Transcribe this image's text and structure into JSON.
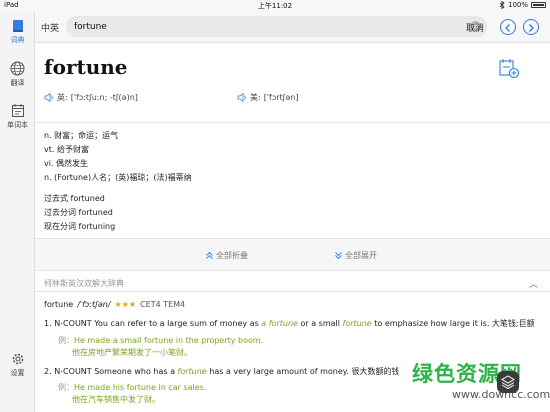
{
  "status": {
    "device": "iPad",
    "time": "上午11:02",
    "battery": "100%"
  },
  "sidebar": {
    "items": [
      {
        "label": "词典",
        "icon": "book-icon"
      },
      {
        "label": "翻译",
        "icon": "globe-icon"
      },
      {
        "label": "单词本",
        "icon": "calendar-icon"
      },
      {
        "label": "设置",
        "icon": "gear-icon"
      }
    ],
    "active_color": "#2f7fd8"
  },
  "topbar": {
    "lang": "中英",
    "query": "fortune",
    "placeholder": "",
    "cancel": "取消"
  },
  "word": {
    "headword": "fortune",
    "uk_label": "英:",
    "uk_ipa": "['fɔːtʃuːn; -tʃ(ə)n]",
    "us_label": "美:",
    "us_ipa": "['fɔrtʃən]"
  },
  "definitions": [
    "n. 财富；命运；运气",
    "vt. 给予财富",
    "vi. 偶然发生",
    "n. (Fortune)人名；(英)福琼；(法)福蒂纳"
  ],
  "forms": [
    "过去式 fortuned",
    "过去分词 fortuned",
    "现在分词 fortuning"
  ],
  "expand": {
    "collapse_all": "全部折叠",
    "expand_all": "全部展开"
  },
  "collins": {
    "title": "柯林斯英汉双解大辞典",
    "word": "fortune",
    "phonetic": "/ˈfɔːtʃən/",
    "stars": "★★★",
    "levels": "CET4 TEM4",
    "senses": [
      {
        "num": "1.",
        "pre": "N-COUNT You can refer to a large sum of money as ",
        "kw1": "a fortune",
        "mid": " or a small ",
        "kw2": "fortune",
        "post": " to emphasize how large it is. 大笔钱;巨额",
        "ex_label": "例：",
        "ex_en": "He made a small fortune in the property boom.",
        "ex_zh": "他在房地产繁荣期发了一小笔财。"
      },
      {
        "num": "2.",
        "pre": "N-COUNT Someone who has a ",
        "kw1": "fortune",
        "mid": " has a very large amount of money. 很大数额的钱",
        "kw2": "",
        "post": "",
        "ex_label": "例：",
        "ex_en": "He made his fortune in car sales.",
        "ex_zh": "他在汽车销售中发了财。"
      }
    ]
  },
  "watermark": {
    "big": "绿色资源网",
    "small": "www.downcc.com"
  }
}
